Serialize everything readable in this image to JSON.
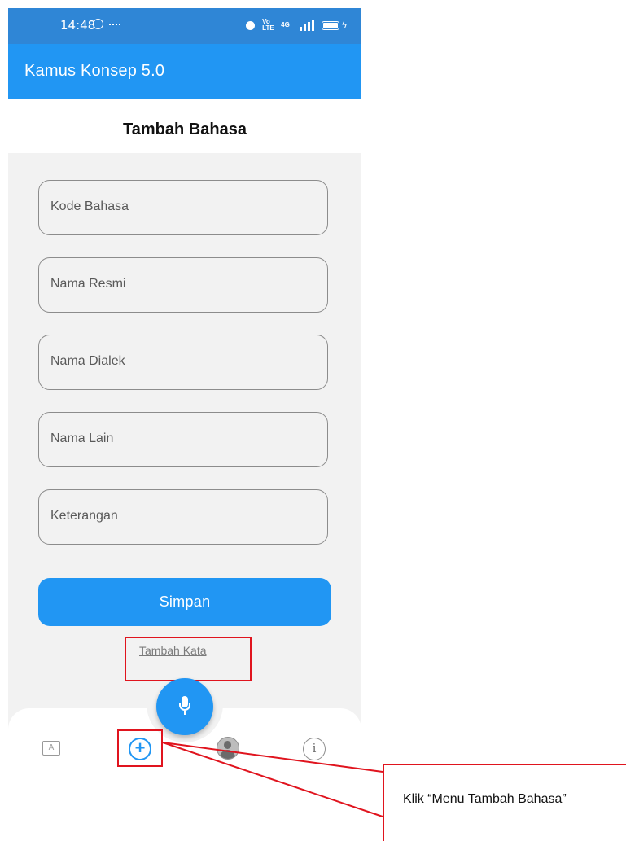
{
  "status_bar": {
    "time": "14:48",
    "volte_label": "Vo LTE",
    "network_label": "4G"
  },
  "app_bar": {
    "title": "Kamus Konsep 5.0"
  },
  "page": {
    "title": "Tambah Bahasa"
  },
  "form": {
    "fields": [
      {
        "placeholder": "Kode Bahasa"
      },
      {
        "placeholder": "Nama Resmi"
      },
      {
        "placeholder": "Nama Dialek"
      },
      {
        "placeholder": "Nama Lain"
      },
      {
        "placeholder": "Keterangan"
      }
    ],
    "submit_label": "Simpan",
    "link_label": "Tambah Kata"
  },
  "fab": {
    "icon": "mic-icon"
  },
  "bottom_nav": {
    "items": [
      {
        "icon": "translate-icon",
        "glyph": "A"
      },
      {
        "icon": "plus-circle-icon",
        "glyph": "+"
      },
      {
        "icon": "profile-icon"
      },
      {
        "icon": "info-icon",
        "glyph": "i"
      }
    ]
  },
  "annotation": {
    "callout": "Klik “Menu Tambah Bahasa”",
    "highlight_color": "#e0141e"
  },
  "colors": {
    "primary": "#2196f3",
    "status_bar": "#2f86d6",
    "form_background": "#f2f2f2"
  }
}
